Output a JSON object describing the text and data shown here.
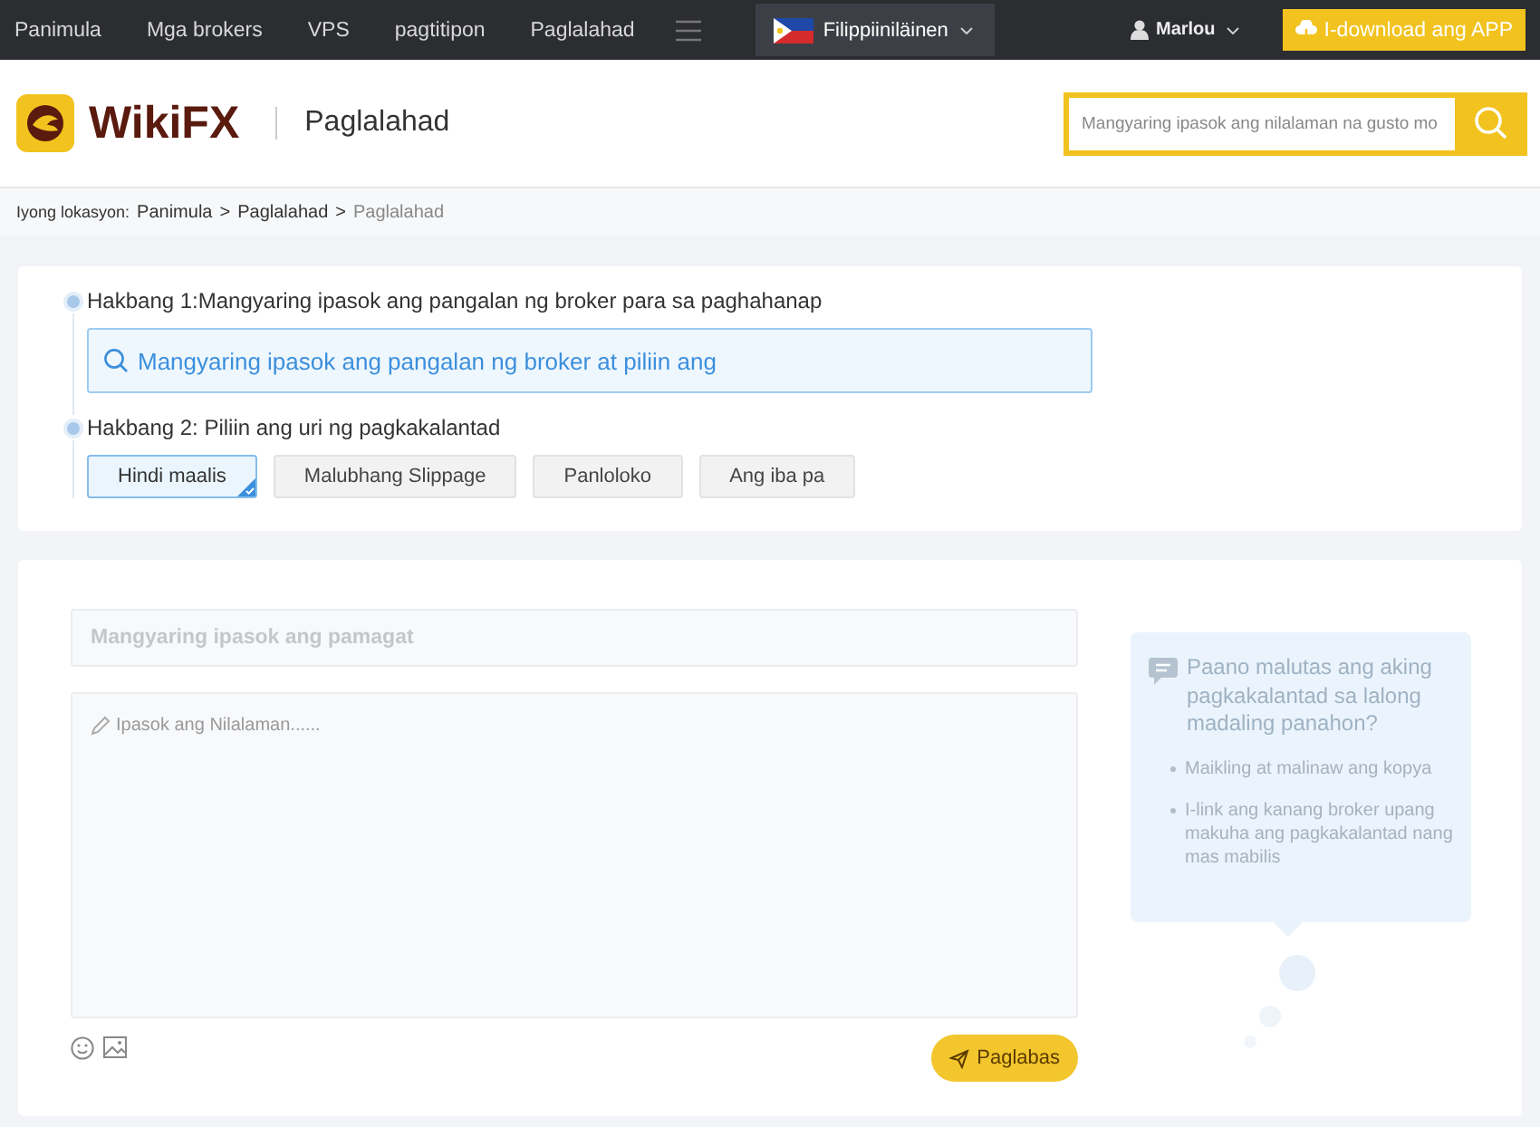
{
  "top_nav": {
    "links": [
      "Panimula",
      "Mga brokers",
      "VPS",
      "pagtitipon",
      "Paglalahad"
    ],
    "language": "Filippiiniläinen",
    "user": "Marlou",
    "download_button": "I-download ang APP"
  },
  "header": {
    "logo": "WikiFX",
    "page_title": "Paglalahad",
    "search": {
      "placeholder": "Mangyaring ipasok ang nilalaman na gusto mo"
    }
  },
  "breadcrumb": {
    "label": "Iyong lokasyon:",
    "items": [
      "Panimula",
      "Paglalahad",
      "Paglalahad"
    ],
    "separators": [
      ">",
      ">"
    ]
  },
  "step1": {
    "label": "Hakbang 1:Mangyaring ipasok ang pangalan ng broker para sa paghahanap",
    "search": {
      "placeholder": "Mangyaring ipasok ang pangalan ng broker at piliin ang"
    }
  },
  "step2": {
    "label": "Hakbang 2: Piliin ang uri ng pagkakalantad",
    "categories": [
      {
        "label": "Hindi maalis",
        "selected": true
      },
      {
        "label": "Malubhang Slippage",
        "selected": false
      },
      {
        "label": "Panloloko",
        "selected": false
      },
      {
        "label": "Ang iba pa",
        "selected": false
      }
    ]
  },
  "form": {
    "title_placeholder": "Mangyaring ipasok ang pamagat",
    "content_placeholder": "Ipasok ang Nilalaman......",
    "submit": "Paglabas"
  },
  "tips": {
    "title": "Paano malutas ang aking pagkakalantad sa lalong madaling panahon?",
    "items": [
      "Maikling at malinaw ang kopya",
      "I-link ang kanang broker upang makuha ang pagkakalantad nang mas mabilis"
    ]
  }
}
